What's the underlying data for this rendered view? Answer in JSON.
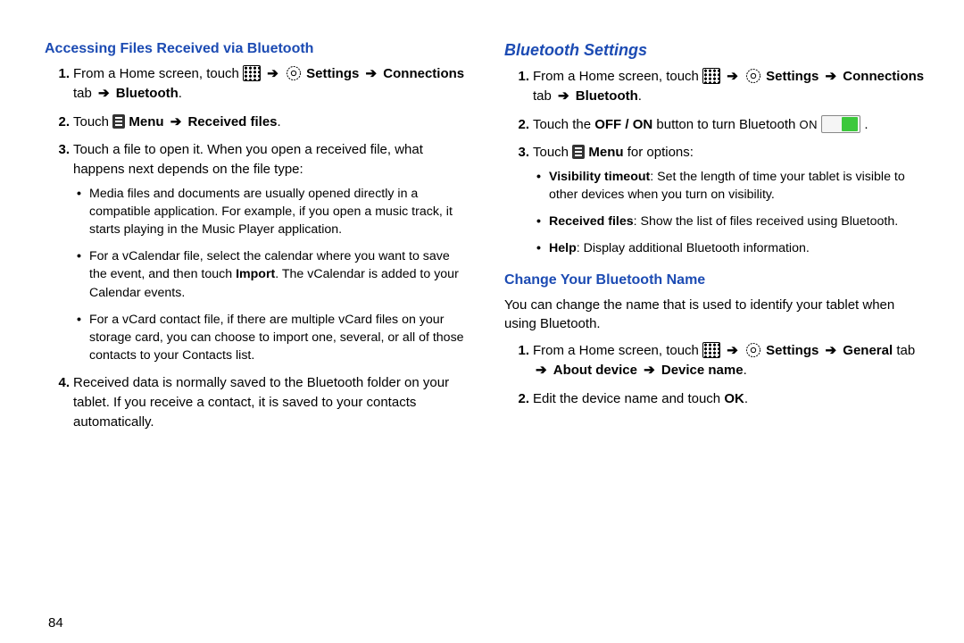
{
  "page_number": "84",
  "left": {
    "heading": "Accessing Files Received via Bluetooth",
    "step1_pre": "From a Home screen, touch ",
    "step1_settings": "Settings",
    "step1_conn": "Connections",
    "step1_tab": " tab ",
    "step1_bt": "Bluetooth",
    "step2_pre": "Touch ",
    "step2_menu": "Menu",
    "step2_recv": "Received files",
    "step3": "Touch a file to open it. When you open a received file, what happens next depends on the file type:",
    "bullet1": "Media files and documents are usually opened directly in a compatible application. For example, if you open a music track, it starts playing in the Music Player application.",
    "bullet2a": "For a vCalendar file, select the calendar where you want to save the event, and then touch ",
    "bullet2_import": "Import",
    "bullet2b": ". The vCalendar is added to your Calendar events.",
    "bullet3": "For a vCard contact file, if there are multiple vCard files on your storage card, you can choose to import one, several, or all of those contacts to your Contacts list.",
    "step4": "Received data is normally saved to the Bluetooth folder on your tablet. If you receive a contact, it is saved to your contacts automatically."
  },
  "right": {
    "heading_main": "Bluetooth Settings",
    "step1_pre": "From a Home screen, touch ",
    "step1_settings": "Settings",
    "step1_conn": "Connections",
    "step1_tab": " tab ",
    "step1_bt": "Bluetooth",
    "step2a": "Touch the ",
    "step2_offon": "OFF / ON",
    "step2b": " button to turn Bluetooth ",
    "step2_on": "ON ",
    "step3_pre": "Touch ",
    "step3_menu": "Menu",
    "step3_post": " for options:",
    "bullet1_label": "Visibility timeout",
    "bullet1_text": ": Set the length of time your tablet is visible to other devices when you turn on visibility.",
    "bullet2_label": "Received files",
    "bullet2_text": ": Show the list of files received using Bluetooth.",
    "bullet3_label": "Help",
    "bullet3_text": ": Display additional Bluetooth information.",
    "heading_sub": "Change Your Bluetooth Name",
    "intro": "You can change the name that is used to identify your tablet when using Bluetooth.",
    "s1_pre": "From a Home screen, touch ",
    "s1_settings": "Settings",
    "s1_general": "General",
    "s1_tab": " tab ",
    "s1_about": "About device",
    "s1_devname": "Device name",
    "s2a": "Edit the device name and touch ",
    "s2_ok": "OK",
    "s2b": "."
  },
  "arrow": "➔",
  "period": "."
}
